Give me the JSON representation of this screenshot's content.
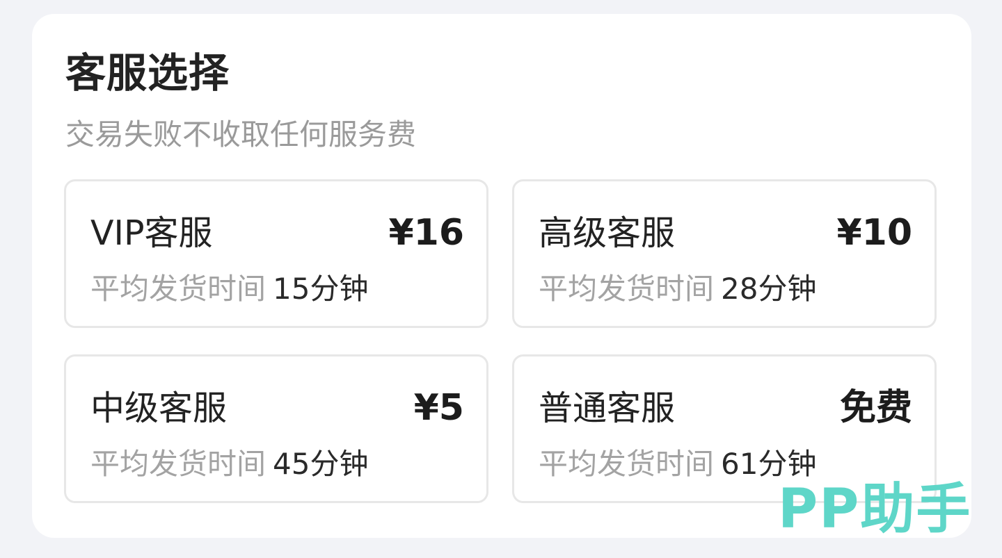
{
  "header": {
    "title": "客服选择",
    "subtitle": "交易失败不收取任何服务费"
  },
  "options": [
    {
      "name": "VIP客服",
      "price": "¥16",
      "time_label": "平均发货时间",
      "time_value": "15分钟"
    },
    {
      "name": "高级客服",
      "price": "¥10",
      "time_label": "平均发货时间",
      "time_value": "28分钟"
    },
    {
      "name": "中级客服",
      "price": "¥5",
      "time_label": "平均发货时间",
      "time_value": "45分钟"
    },
    {
      "name": "普通客服",
      "price": "免费",
      "time_label": "平均发货时间",
      "time_value": "61分钟"
    }
  ],
  "watermark": "PP助手",
  "colors": {
    "background": "#f2f3f7",
    "panel": "#ffffff",
    "card_border": "#e7e7e7",
    "secondary_text": "#a3a3a3",
    "watermark": "#5ed6c8"
  }
}
